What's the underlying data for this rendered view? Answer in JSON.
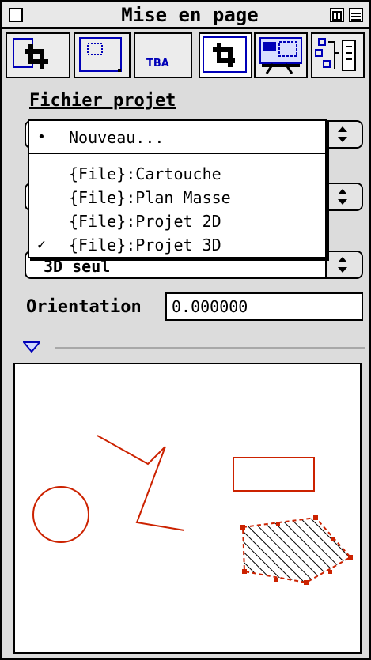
{
  "window": {
    "title": "Mise en page"
  },
  "toolbar": {
    "tba_label": "TBA"
  },
  "fichier": {
    "label": "Fichier projet",
    "menu_items": [
      {
        "label": "Nouveau...",
        "mark": "•"
      },
      {
        "label": "{File}:Cartouche",
        "mark": ""
      },
      {
        "label": "{File}:Plan Masse",
        "mark": ""
      },
      {
        "label": "{File}:Projet 2D",
        "mark": ""
      },
      {
        "label": "{File}:Projet 3D",
        "mark": "✓"
      }
    ]
  },
  "popup3": {
    "value": "3D seul"
  },
  "orientation": {
    "label": "Orientation",
    "value": "0.000000"
  },
  "colors": {
    "drawing": "#cc2200",
    "accent": "#0000b8"
  }
}
